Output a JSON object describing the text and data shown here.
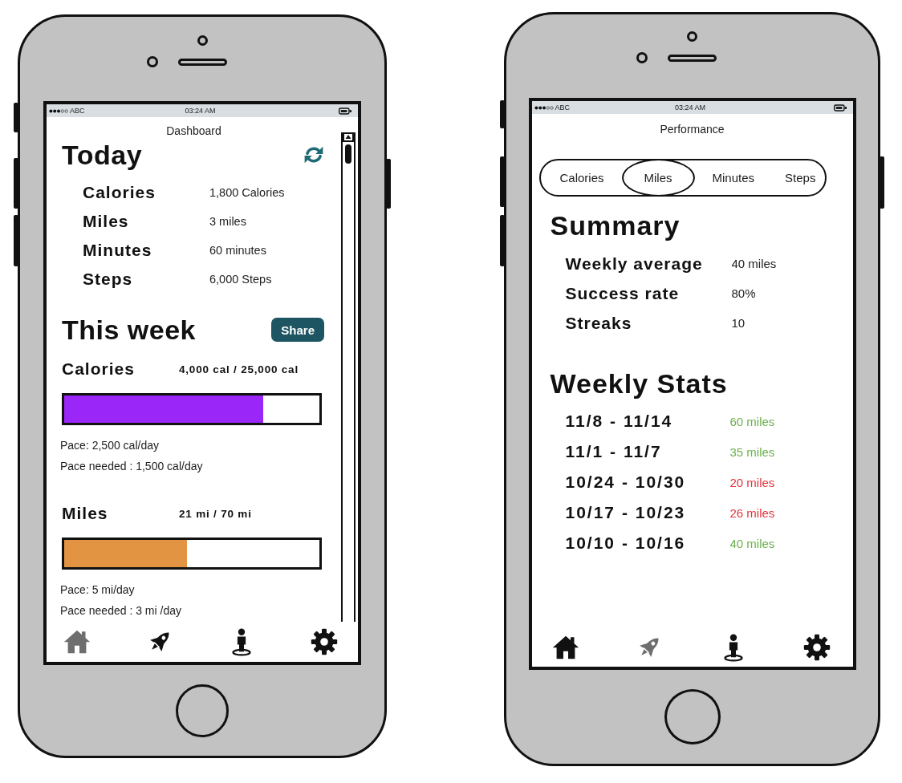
{
  "dashboard": {
    "status_bar": {
      "carrier": "ABC",
      "time": "03:24 AM"
    },
    "title": "Dashboard",
    "today": {
      "heading": "Today",
      "rows": [
        {
          "label": "Calories",
          "value": "1,800 Calories"
        },
        {
          "label": "Miles",
          "value": "3 miles"
        },
        {
          "label": "Minutes",
          "value": "60 minutes"
        },
        {
          "label": "Steps",
          "value": "6,000 Steps"
        }
      ]
    },
    "this_week": {
      "heading": "This week",
      "share_button": "Share",
      "metrics": [
        {
          "label": "Calories",
          "total": "4,000 cal / 25,000 cal",
          "level": 0.78,
          "color": "#9b26f8",
          "pace": "Pace: 2,500 cal/day",
          "pace_needed": "Pace needed : 1,500 cal/day"
        },
        {
          "label": "Miles",
          "total": "21 mi / 70 mi",
          "level": 0.48,
          "color": "#e39442",
          "pace": "Pace: 5 mi/day",
          "pace_needed": "Pace needed : 3 mi /day"
        }
      ]
    },
    "nav": [
      {
        "kind": "home",
        "selected": true
      },
      {
        "kind": "rocket",
        "selected": false
      },
      {
        "kind": "person",
        "selected": false
      },
      {
        "kind": "gear",
        "selected": false
      }
    ]
  },
  "performance": {
    "status_bar": {
      "carrier": "ABC",
      "time": "03:24 AM"
    },
    "title": "Performance",
    "tabs": [
      {
        "label": "Calories",
        "selected": false
      },
      {
        "label": "Miles",
        "selected": true
      },
      {
        "label": "Minutes",
        "selected": false
      },
      {
        "label": "Steps",
        "selected": false
      }
    ],
    "summary": {
      "heading": "Summary",
      "rows": [
        {
          "label": "Weekly average",
          "value": "40 miles"
        },
        {
          "label": "Success rate",
          "value": "80%"
        },
        {
          "label": "Streaks",
          "value": "10"
        }
      ]
    },
    "weekly_stats": {
      "heading": "Weekly Stats",
      "rows": [
        {
          "range": "11/8 - 11/14",
          "value": "60 miles",
          "color": "#6ab04c"
        },
        {
          "range": "11/1 - 11/7",
          "value": "35 miles",
          "color": "#6ab04c"
        },
        {
          "range": "10/24 - 10/30",
          "value": "20 miles",
          "color": "#e0343c"
        },
        {
          "range": "10/17 - 10/23",
          "value": "26 miles",
          "color": "#e0343c"
        },
        {
          "range": "10/10 - 10/16",
          "value": "40 miles",
          "color": "#6ab04c"
        }
      ]
    },
    "nav": [
      {
        "kind": "home",
        "selected": false
      },
      {
        "kind": "rocket",
        "selected": true
      },
      {
        "kind": "person",
        "selected": false
      },
      {
        "kind": "gear",
        "selected": false
      }
    ]
  }
}
